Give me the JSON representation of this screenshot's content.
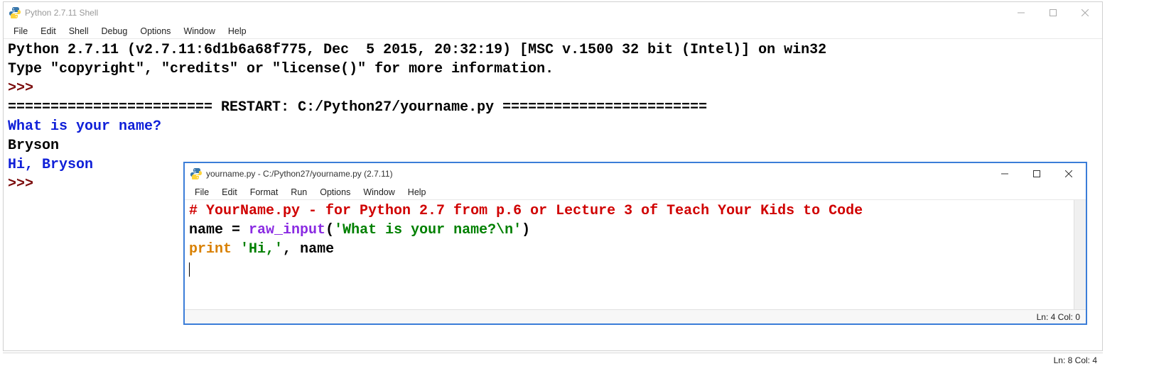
{
  "shell": {
    "title": "Python 2.7.11 Shell",
    "menu": [
      "File",
      "Edit",
      "Shell",
      "Debug",
      "Options",
      "Window",
      "Help"
    ],
    "lines": {
      "banner1": "Python 2.7.11 (v2.7.11:6d1b6a68f775, Dec  5 2015, 20:32:19) [MSC v.1500 32 bit (Intel)] on win32",
      "banner2": "Type \"copyright\", \"credits\" or \"license()\" for more information.",
      "prompt1": ">>> ",
      "restart": "======================== RESTART: C:/Python27/yourname.py ========================",
      "q": "What is your name?",
      "input": "Bryson",
      "out": "Hi, Bryson",
      "prompt2": ">>> "
    },
    "status": "Ln: 8  Col: 4"
  },
  "editor": {
    "title": "yourname.py - C:/Python27/yourname.py (2.7.11)",
    "menu": [
      "File",
      "Edit",
      "Format",
      "Run",
      "Options",
      "Window",
      "Help"
    ],
    "code": {
      "comment": "# YourName.py - for Python 2.7 from p.6 or Lecture 3 of Teach Your Kids to Code",
      "l2_name": "name ",
      "l2_eq": "= ",
      "l2_func": "raw_input",
      "l2_paren_o": "(",
      "l2_str": "'What is your name?\\n'",
      "l2_paren_c": ")",
      "l3_print": "print",
      "l3_sp": " ",
      "l3_str": "'Hi,'",
      "l3_comma": ", ",
      "l3_name": "name"
    },
    "status": "Ln: 4  Col: 0"
  },
  "icons": {
    "python": "python-icon"
  }
}
